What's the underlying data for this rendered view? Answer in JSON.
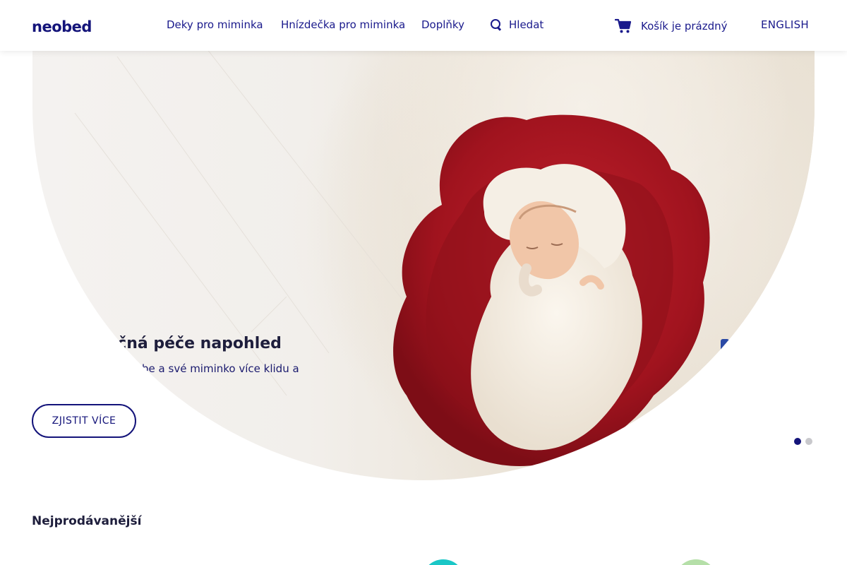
{
  "brand": {
    "logo": "neobed"
  },
  "nav": {
    "items": [
      {
        "label": "Deky pro miminka"
      },
      {
        "label": "Hnízdečka pro miminka"
      },
      {
        "label": "Doplňky"
      }
    ],
    "search_label": "Hledat",
    "search_icon": "search-icon",
    "cart_label": "Košík je prázdný",
    "cart_icon": "cart-icon",
    "language": "ENGLISH"
  },
  "hero": {
    "title": "Bezpečná péče napohled",
    "subtitle": "Získejte pro sebe a své miminko více klidu a pohody.",
    "button_label": "ZJISTIT VÍCE",
    "slides": {
      "count": 2,
      "active": 1
    }
  },
  "sections": {
    "bestsellers_title": "Nejprodávanější"
  },
  "colors": {
    "brand": "#14147a",
    "nest_red": "#a3141f",
    "accent_teal": "#1ac7c7",
    "accent_green": "#b5dfa8"
  }
}
